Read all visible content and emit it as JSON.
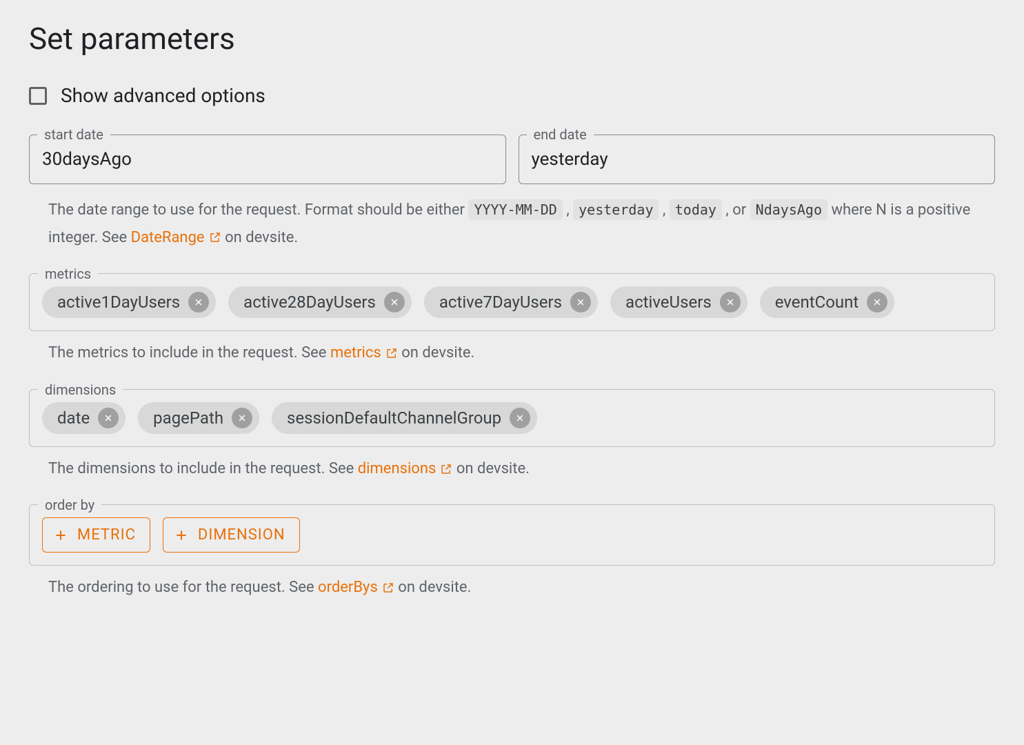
{
  "title": "Set parameters",
  "advanced": {
    "label": "Show advanced options",
    "checked": false
  },
  "dates": {
    "start_label": "start date",
    "start_value": "30daysAgo",
    "end_label": "end date",
    "end_value": "yesterday",
    "help_pre": "The date range to use for the request. Format should be either ",
    "codes": [
      "YYYY-MM-DD",
      "yesterday",
      "today",
      "NdaysAgo"
    ],
    "help_or": " , or ",
    "help_mid": " where N is a positive integer. See ",
    "link_text": "DateRange",
    "help_post": " on devsite."
  },
  "metrics": {
    "legend": "metrics",
    "chips": [
      "active1DayUsers",
      "active28DayUsers",
      "active7DayUsers",
      "activeUsers",
      "eventCount"
    ],
    "help_pre": "The metrics to include in the request. See ",
    "link_text": "metrics",
    "help_post": " on devsite."
  },
  "dimensions": {
    "legend": "dimensions",
    "chips": [
      "date",
      "pagePath",
      "sessionDefaultChannelGroup"
    ],
    "help_pre": "The dimensions to include in the request. See ",
    "link_text": "dimensions",
    "help_post": " on devsite."
  },
  "orderby": {
    "legend": "order by",
    "metric_btn": "METRIC",
    "dimension_btn": "DIMENSION",
    "help_pre": "The ordering to use for the request. See ",
    "link_text": "orderBys",
    "help_post": " on devsite."
  }
}
